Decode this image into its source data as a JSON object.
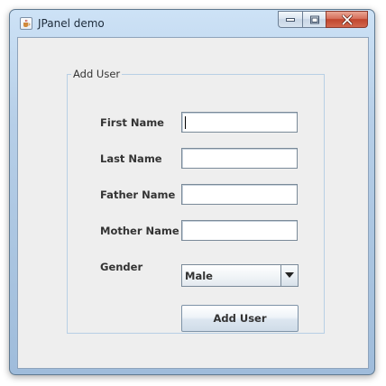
{
  "window": {
    "title": "JPanel demo",
    "icon": "java-cup-icon",
    "controls": {
      "minimize_icon": "minimize-icon",
      "maximize_icon": "maximize-icon",
      "close_icon": "close-icon",
      "close_color": "#c7452e"
    }
  },
  "form": {
    "legend": "Add User",
    "fields": [
      {
        "label": "First Name",
        "value": "",
        "focused": true
      },
      {
        "label": "Last Name",
        "value": ""
      },
      {
        "label": "Father Name",
        "value": ""
      },
      {
        "label": "Mother Name",
        "value": ""
      }
    ],
    "gender": {
      "label": "Gender",
      "selected": "Male"
    },
    "submit_label": "Add User"
  }
}
